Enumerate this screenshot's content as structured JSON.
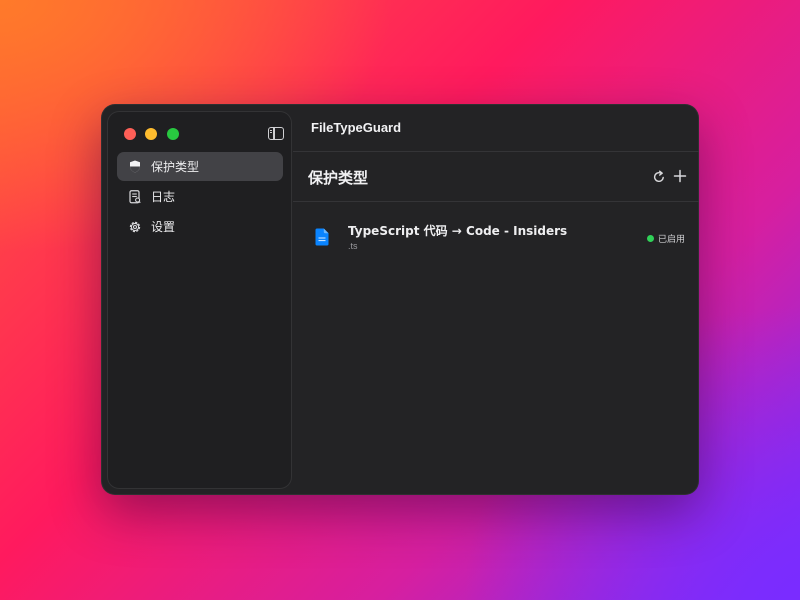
{
  "app": {
    "title": "FileTypeGuard"
  },
  "sidebar": {
    "items": [
      {
        "label": "保护类型",
        "icon": "shield-icon",
        "active": true
      },
      {
        "label": "日志",
        "icon": "log-icon",
        "active": false
      },
      {
        "label": "设置",
        "icon": "gear-icon",
        "active": false
      }
    ]
  },
  "main": {
    "section_title": "保护类型",
    "toolbar": {
      "refresh_icon": "refresh-icon",
      "add_icon": "plus-icon"
    },
    "rows": [
      {
        "title": "TypeScript 代码 → Code - Insiders",
        "extension": ".ts",
        "status": "已启用",
        "status_color": "#30d158",
        "icon": "file-icon",
        "icon_color": "#0a84ff"
      }
    ]
  }
}
